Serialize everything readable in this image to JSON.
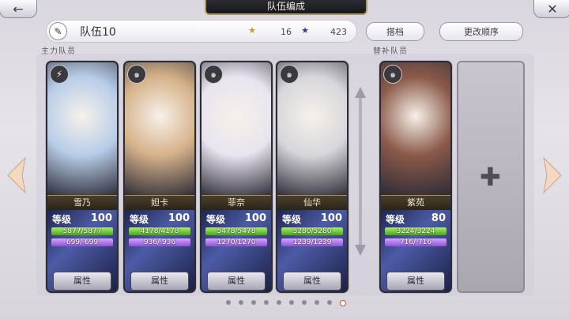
{
  "header": {
    "title": "队伍编成",
    "back_icon": "back-arrow-icon",
    "close_icon": "close-icon"
  },
  "team": {
    "name": "队伍10",
    "stat1_value": "16",
    "stat2_value": "423",
    "partner_button": "搭档",
    "order_button": "更改顺序"
  },
  "sections": {
    "main": "主力队员",
    "support": "替补队员"
  },
  "cards": [
    {
      "name": "雪乃",
      "level_label": "等级",
      "level": "100",
      "hp": "5877/5877",
      "hp_pct": 1,
      "mp": "699/ 699",
      "mp_pct": 1,
      "attr": "属性",
      "role_icon": "lightning-icon",
      "portrait": "#b8cde8"
    },
    {
      "name": "妲卡",
      "level_label": "等级",
      "level": "100",
      "hp": "4178/4178",
      "hp_pct": 1,
      "mp": "936/ 936",
      "mp_pct": 1,
      "attr": "属性",
      "role_icon": "swirl-icon",
      "portrait": "#d6b28a"
    },
    {
      "name": "菲奈",
      "level_label": "等级",
      "level": "100",
      "hp": "5478/5478",
      "hp_pct": 1,
      "mp": "1270/1270",
      "mp_pct": 1,
      "attr": "属性",
      "role_icon": "swirl-icon",
      "portrait": "#e9e4ef"
    },
    {
      "name": "仙华",
      "level_label": "等级",
      "level": "100",
      "hp": "5280/5280",
      "hp_pct": 1,
      "mp": "1239/1239",
      "mp_pct": 1,
      "attr": "属性",
      "role_icon": "swirl-icon",
      "portrait": "#d7d6db"
    },
    {
      "name": "紫苑",
      "level_label": "等级",
      "level": "80",
      "hp": "3224/3224",
      "hp_pct": 1,
      "mp": "716/ 716",
      "mp_pct": 1,
      "attr": "属性",
      "role_icon": "swirl-icon",
      "portrait": "#8b5a4a"
    }
  ],
  "pagination": {
    "total": 10,
    "active": 9
  }
}
